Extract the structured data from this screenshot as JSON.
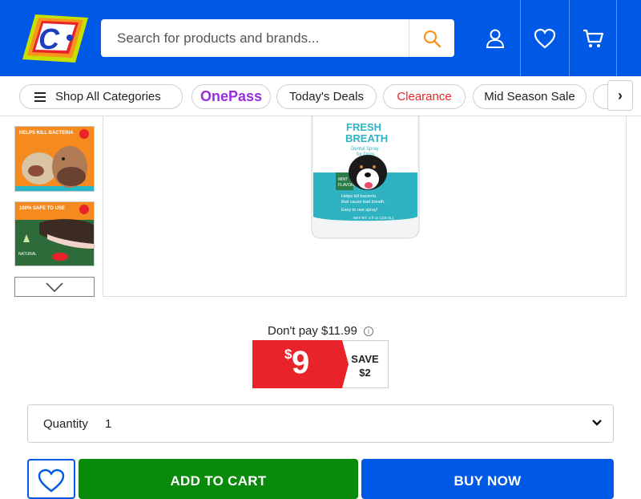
{
  "header": {
    "brand_color": "#0058e6",
    "logo_letter": "C",
    "search": {
      "placeholder": "Search for products and brands..."
    },
    "icons": [
      "account-icon",
      "heart-icon",
      "cart-icon"
    ]
  },
  "nav": {
    "shop_all": "Shop All Categories",
    "onepass": "OnePass",
    "todays_deals": "Today's Deals",
    "clearance": "Clearance",
    "mid_season": "Mid Season Sale",
    "next_arrow": "›"
  },
  "gallery": {
    "thumb1_caption": "HELPS KILL BACTERIA",
    "thumb2_caption": "100% SAFE TO USE",
    "thumb2_badge": "NATURAL",
    "product": {
      "title_line1": "FRESH",
      "title_line2": "BREATH",
      "subtitle_line1": "Dental Spray",
      "subtitle_line2": "for Dogs",
      "flavor_line1": "MINT",
      "flavor_line2": "FLAVOR",
      "claim_line1": "Helps kill bacteria",
      "claim_line2": "that cause bad breath.",
      "claim_line3": "Easy to use spray!",
      "net_wt": "NET WT. 4 fl oz (118 mL)"
    }
  },
  "pricing": {
    "dont_pay": "Don't pay $11.99",
    "currency": "$",
    "price": "9",
    "save_label": "SAVE",
    "save_amount": "$2",
    "price_color": "#e8242a"
  },
  "quantity": {
    "label": "Quantity",
    "value": "1",
    "chevron": "❯"
  },
  "actions": {
    "add_to_cart": "ADD TO CART",
    "buy_now": "BUY NOW",
    "add_color": "#0a8a0a",
    "buy_color": "#0058e6"
  }
}
